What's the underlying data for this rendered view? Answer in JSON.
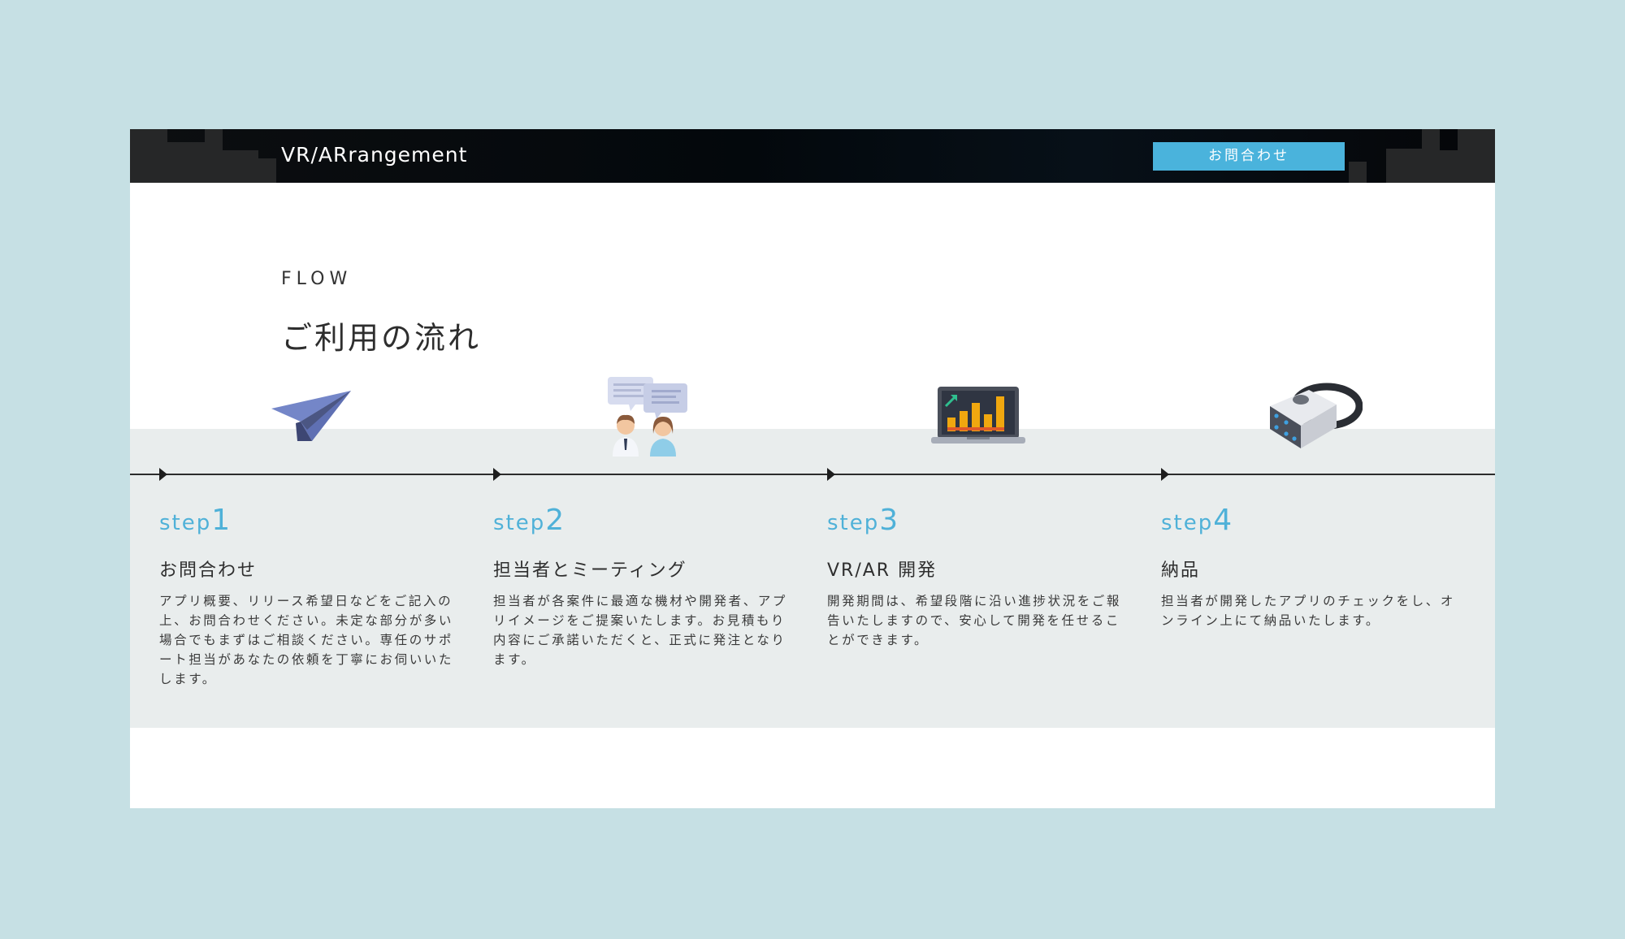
{
  "header": {
    "logo": "VR/ARrangement",
    "contact_button": "お問合わせ"
  },
  "section": {
    "eyebrow": "FLOW",
    "title": "ご利用の流れ"
  },
  "steps": [
    {
      "label": "step",
      "number": "1",
      "icon": "paper-plane-icon",
      "title": "お問合わせ",
      "description": "アプリ概要、リリース希望日などをご記入の上、お問合わせください。未定な部分が多い場合でもまずはご相談ください。専任のサポート担当があなたの依頼を丁寧にお伺いいたします。"
    },
    {
      "label": "step",
      "number": "2",
      "icon": "meeting-people-icon",
      "title": "担当者とミーティング",
      "description": "担当者が各案件に最適な機材や開発者、アプリイメージをご提案いたします。お見積もり内容にご承諾いただくと、正式に発注となります。"
    },
    {
      "label": "step",
      "number": "3",
      "icon": "laptop-chart-icon",
      "title": "VR/AR 開発",
      "description": "開発期間は、希望段階に沿い進捗状況をご報告いたしますので、安心して開発を任せることができます。"
    },
    {
      "label": "step",
      "number": "4",
      "icon": "vr-headset-icon",
      "title": "納品",
      "description": "担当者が開発したアプリのチェックをし、オンライン上にて納品いたします。"
    }
  ],
  "colors": {
    "accent": "#4ab3dc",
    "step_label": "#4fb1d8",
    "band": "#e9eded",
    "page_background": "#c6e0e4"
  }
}
